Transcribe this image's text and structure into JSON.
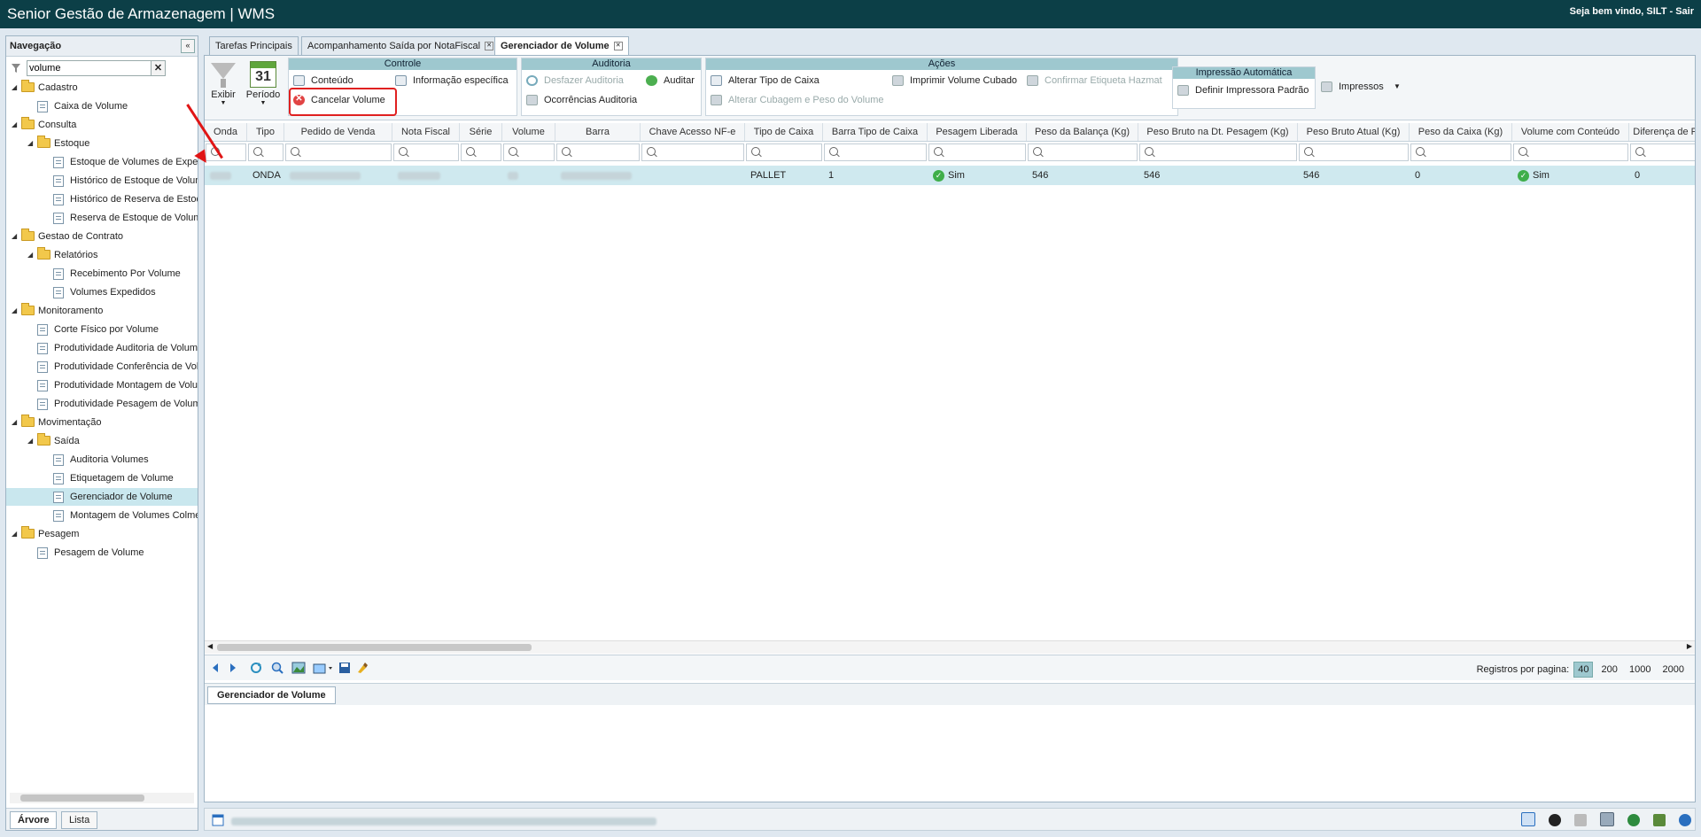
{
  "app": {
    "title": "Senior Gestão de Armazenagem | WMS",
    "welcome": "Seja bem vindo, SILT - Sair"
  },
  "nav": {
    "title": "Navegação",
    "search_value": "volume",
    "clear_label": "✕",
    "collapse_label": "«",
    "tree": [
      {
        "label": "Cadastro",
        "type": "folder",
        "level": 0
      },
      {
        "label": "Caixa de Volume",
        "type": "page",
        "level": 1
      },
      {
        "label": "Consulta",
        "type": "folder",
        "level": 0
      },
      {
        "label": "Estoque",
        "type": "folder",
        "level": 1
      },
      {
        "label": "Estoque de Volumes de Expedição",
        "type": "page",
        "level": 2
      },
      {
        "label": "Histórico de Estoque de Volume",
        "type": "page",
        "level": 2
      },
      {
        "label": "Histórico de Reserva de Estoque",
        "type": "page",
        "level": 2
      },
      {
        "label": "Reserva de Estoque de Volume",
        "type": "page",
        "level": 2
      },
      {
        "label": "Gestao de Contrato",
        "type": "folder",
        "level": 0
      },
      {
        "label": "Relatórios",
        "type": "folder",
        "level": 1
      },
      {
        "label": "Recebimento Por Volume",
        "type": "page",
        "level": 2
      },
      {
        "label": "Volumes Expedidos",
        "type": "page",
        "level": 2
      },
      {
        "label": "Monitoramento",
        "type": "folder",
        "level": 0
      },
      {
        "label": "Corte Físico por Volume",
        "type": "page",
        "level": 1
      },
      {
        "label": "Produtividade Auditoria de Volume",
        "type": "page",
        "level": 1
      },
      {
        "label": "Produtividade Conferência de Volume",
        "type": "page",
        "level": 1
      },
      {
        "label": "Produtividade Montagem de Volume",
        "type": "page",
        "level": 1
      },
      {
        "label": "Produtividade Pesagem de Volume",
        "type": "page",
        "level": 1
      },
      {
        "label": "Movimentação",
        "type": "folder",
        "level": 0
      },
      {
        "label": "Saída",
        "type": "folder",
        "level": 1
      },
      {
        "label": "Auditoria Volumes",
        "type": "page",
        "level": 2
      },
      {
        "label": "Etiquetagem de Volume",
        "type": "page",
        "level": 2
      },
      {
        "label": "Gerenciador de Volume",
        "type": "page",
        "level": 2,
        "selected": true
      },
      {
        "label": "Montagem de Volumes Colmeia",
        "type": "page",
        "level": 2
      },
      {
        "label": "Pesagem",
        "type": "folder",
        "level": 0
      },
      {
        "label": "Pesagem de Volume",
        "type": "page",
        "level": 1
      }
    ],
    "bottom_tabs": [
      "Árvore",
      "Lista"
    ]
  },
  "tabs": [
    {
      "label": "Tarefas Principais",
      "closable": false
    },
    {
      "label": "Acompanhamento Saída por NotaFiscal",
      "closable": true
    },
    {
      "label": "Gerenciador de Volume",
      "closable": true,
      "active": true
    }
  ],
  "toolbar": {
    "exibir": "Exibir",
    "periodo": "Período",
    "calendar_day": "31",
    "controle": {
      "title": "Controle",
      "conteudo": "Conteúdo",
      "info": "Informação específica",
      "cancelar": "Cancelar Volume"
    },
    "auditoria": {
      "title": "Auditoria",
      "desfazer": "Desfazer Auditoria",
      "auditar": "Auditar",
      "ocorrencias": "Ocorrências Auditoria"
    },
    "acoes": {
      "title": "Ações",
      "alterar_tipo": "Alterar Tipo de Caixa",
      "imprimir": "Imprimir Volume Cubado",
      "confirmar": "Confirmar Etiqueta Hazmat",
      "alterar_cubagem": "Alterar Cubagem e Peso do Volume"
    },
    "impressao": {
      "title": "Impressão Automática",
      "definir": "Definir Impressora Padrão"
    },
    "impressos": "Impressos"
  },
  "grid": {
    "columns": [
      "Onda",
      "Tipo",
      "Pedido de Venda",
      "Nota Fiscal",
      "Série",
      "Volume",
      "Barra",
      "Chave Acesso NF-e",
      "Tipo de Caixa",
      "Barra Tipo de Caixa",
      "Pesagem Liberada",
      "Peso da Balança (Kg)",
      "Peso Bruto na Dt. Pesagem (Kg)",
      "Peso Bruto Atual (Kg)",
      "Peso da Caixa (Kg)",
      "Volume com Conteúdo",
      "Diferença de Peso"
    ],
    "rows": [
      {
        "tipo": "ONDA",
        "tipo_caixa": "PALLET",
        "barra_tipo_caixa": "1",
        "pesagem_liberada": "Sim",
        "peso_balanca": "546",
        "peso_bruto_dt": "546",
        "peso_bruto_atual": "546",
        "peso_caixa": "0",
        "volume_conteudo": "Sim",
        "diferenca": "0"
      }
    ]
  },
  "pager": {
    "label": "Registros por pagina:",
    "options": [
      "40",
      "200",
      "1000",
      "2000"
    ],
    "current": "40"
  },
  "subtab": "Gerenciador de Volume"
}
